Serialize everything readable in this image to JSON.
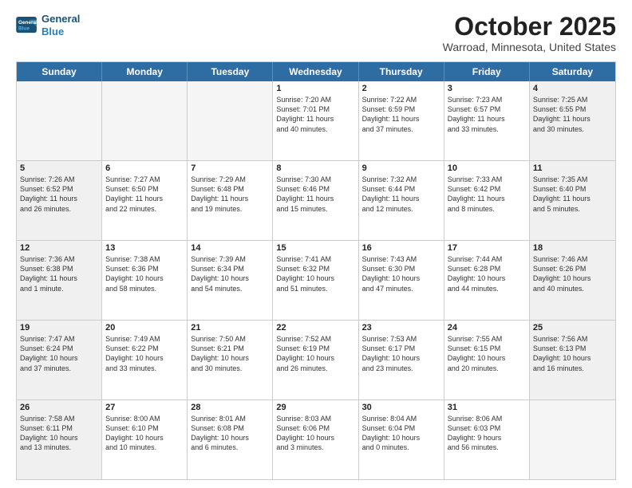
{
  "header": {
    "logo_line1": "General",
    "logo_line2": "Blue",
    "month": "October 2025",
    "location": "Warroad, Minnesota, United States"
  },
  "weekdays": [
    "Sunday",
    "Monday",
    "Tuesday",
    "Wednesday",
    "Thursday",
    "Friday",
    "Saturday"
  ],
  "rows": [
    [
      {
        "day": "",
        "text": "",
        "empty": true
      },
      {
        "day": "",
        "text": "",
        "empty": true
      },
      {
        "day": "",
        "text": "",
        "empty": true
      },
      {
        "day": "1",
        "text": "Sunrise: 7:20 AM\nSunset: 7:01 PM\nDaylight: 11 hours\nand 40 minutes."
      },
      {
        "day": "2",
        "text": "Sunrise: 7:22 AM\nSunset: 6:59 PM\nDaylight: 11 hours\nand 37 minutes."
      },
      {
        "day": "3",
        "text": "Sunrise: 7:23 AM\nSunset: 6:57 PM\nDaylight: 11 hours\nand 33 minutes."
      },
      {
        "day": "4",
        "text": "Sunrise: 7:25 AM\nSunset: 6:55 PM\nDaylight: 11 hours\nand 30 minutes.",
        "shade": true
      }
    ],
    [
      {
        "day": "5",
        "text": "Sunrise: 7:26 AM\nSunset: 6:52 PM\nDaylight: 11 hours\nand 26 minutes.",
        "shade": true
      },
      {
        "day": "6",
        "text": "Sunrise: 7:27 AM\nSunset: 6:50 PM\nDaylight: 11 hours\nand 22 minutes."
      },
      {
        "day": "7",
        "text": "Sunrise: 7:29 AM\nSunset: 6:48 PM\nDaylight: 11 hours\nand 19 minutes."
      },
      {
        "day": "8",
        "text": "Sunrise: 7:30 AM\nSunset: 6:46 PM\nDaylight: 11 hours\nand 15 minutes."
      },
      {
        "day": "9",
        "text": "Sunrise: 7:32 AM\nSunset: 6:44 PM\nDaylight: 11 hours\nand 12 minutes."
      },
      {
        "day": "10",
        "text": "Sunrise: 7:33 AM\nSunset: 6:42 PM\nDaylight: 11 hours\nand 8 minutes."
      },
      {
        "day": "11",
        "text": "Sunrise: 7:35 AM\nSunset: 6:40 PM\nDaylight: 11 hours\nand 5 minutes.",
        "shade": true
      }
    ],
    [
      {
        "day": "12",
        "text": "Sunrise: 7:36 AM\nSunset: 6:38 PM\nDaylight: 11 hours\nand 1 minute.",
        "shade": true
      },
      {
        "day": "13",
        "text": "Sunrise: 7:38 AM\nSunset: 6:36 PM\nDaylight: 10 hours\nand 58 minutes."
      },
      {
        "day": "14",
        "text": "Sunrise: 7:39 AM\nSunset: 6:34 PM\nDaylight: 10 hours\nand 54 minutes."
      },
      {
        "day": "15",
        "text": "Sunrise: 7:41 AM\nSunset: 6:32 PM\nDaylight: 10 hours\nand 51 minutes."
      },
      {
        "day": "16",
        "text": "Sunrise: 7:43 AM\nSunset: 6:30 PM\nDaylight: 10 hours\nand 47 minutes."
      },
      {
        "day": "17",
        "text": "Sunrise: 7:44 AM\nSunset: 6:28 PM\nDaylight: 10 hours\nand 44 minutes."
      },
      {
        "day": "18",
        "text": "Sunrise: 7:46 AM\nSunset: 6:26 PM\nDaylight: 10 hours\nand 40 minutes.",
        "shade": true
      }
    ],
    [
      {
        "day": "19",
        "text": "Sunrise: 7:47 AM\nSunset: 6:24 PM\nDaylight: 10 hours\nand 37 minutes.",
        "shade": true
      },
      {
        "day": "20",
        "text": "Sunrise: 7:49 AM\nSunset: 6:22 PM\nDaylight: 10 hours\nand 33 minutes."
      },
      {
        "day": "21",
        "text": "Sunrise: 7:50 AM\nSunset: 6:21 PM\nDaylight: 10 hours\nand 30 minutes."
      },
      {
        "day": "22",
        "text": "Sunrise: 7:52 AM\nSunset: 6:19 PM\nDaylight: 10 hours\nand 26 minutes."
      },
      {
        "day": "23",
        "text": "Sunrise: 7:53 AM\nSunset: 6:17 PM\nDaylight: 10 hours\nand 23 minutes."
      },
      {
        "day": "24",
        "text": "Sunrise: 7:55 AM\nSunset: 6:15 PM\nDaylight: 10 hours\nand 20 minutes."
      },
      {
        "day": "25",
        "text": "Sunrise: 7:56 AM\nSunset: 6:13 PM\nDaylight: 10 hours\nand 16 minutes.",
        "shade": true
      }
    ],
    [
      {
        "day": "26",
        "text": "Sunrise: 7:58 AM\nSunset: 6:11 PM\nDaylight: 10 hours\nand 13 minutes.",
        "shade": true
      },
      {
        "day": "27",
        "text": "Sunrise: 8:00 AM\nSunset: 6:10 PM\nDaylight: 10 hours\nand 10 minutes."
      },
      {
        "day": "28",
        "text": "Sunrise: 8:01 AM\nSunset: 6:08 PM\nDaylight: 10 hours\nand 6 minutes."
      },
      {
        "day": "29",
        "text": "Sunrise: 8:03 AM\nSunset: 6:06 PM\nDaylight: 10 hours\nand 3 minutes."
      },
      {
        "day": "30",
        "text": "Sunrise: 8:04 AM\nSunset: 6:04 PM\nDaylight: 10 hours\nand 0 minutes."
      },
      {
        "day": "31",
        "text": "Sunrise: 8:06 AM\nSunset: 6:03 PM\nDaylight: 9 hours\nand 56 minutes."
      },
      {
        "day": "",
        "text": "",
        "empty": true,
        "shade": true
      }
    ]
  ]
}
